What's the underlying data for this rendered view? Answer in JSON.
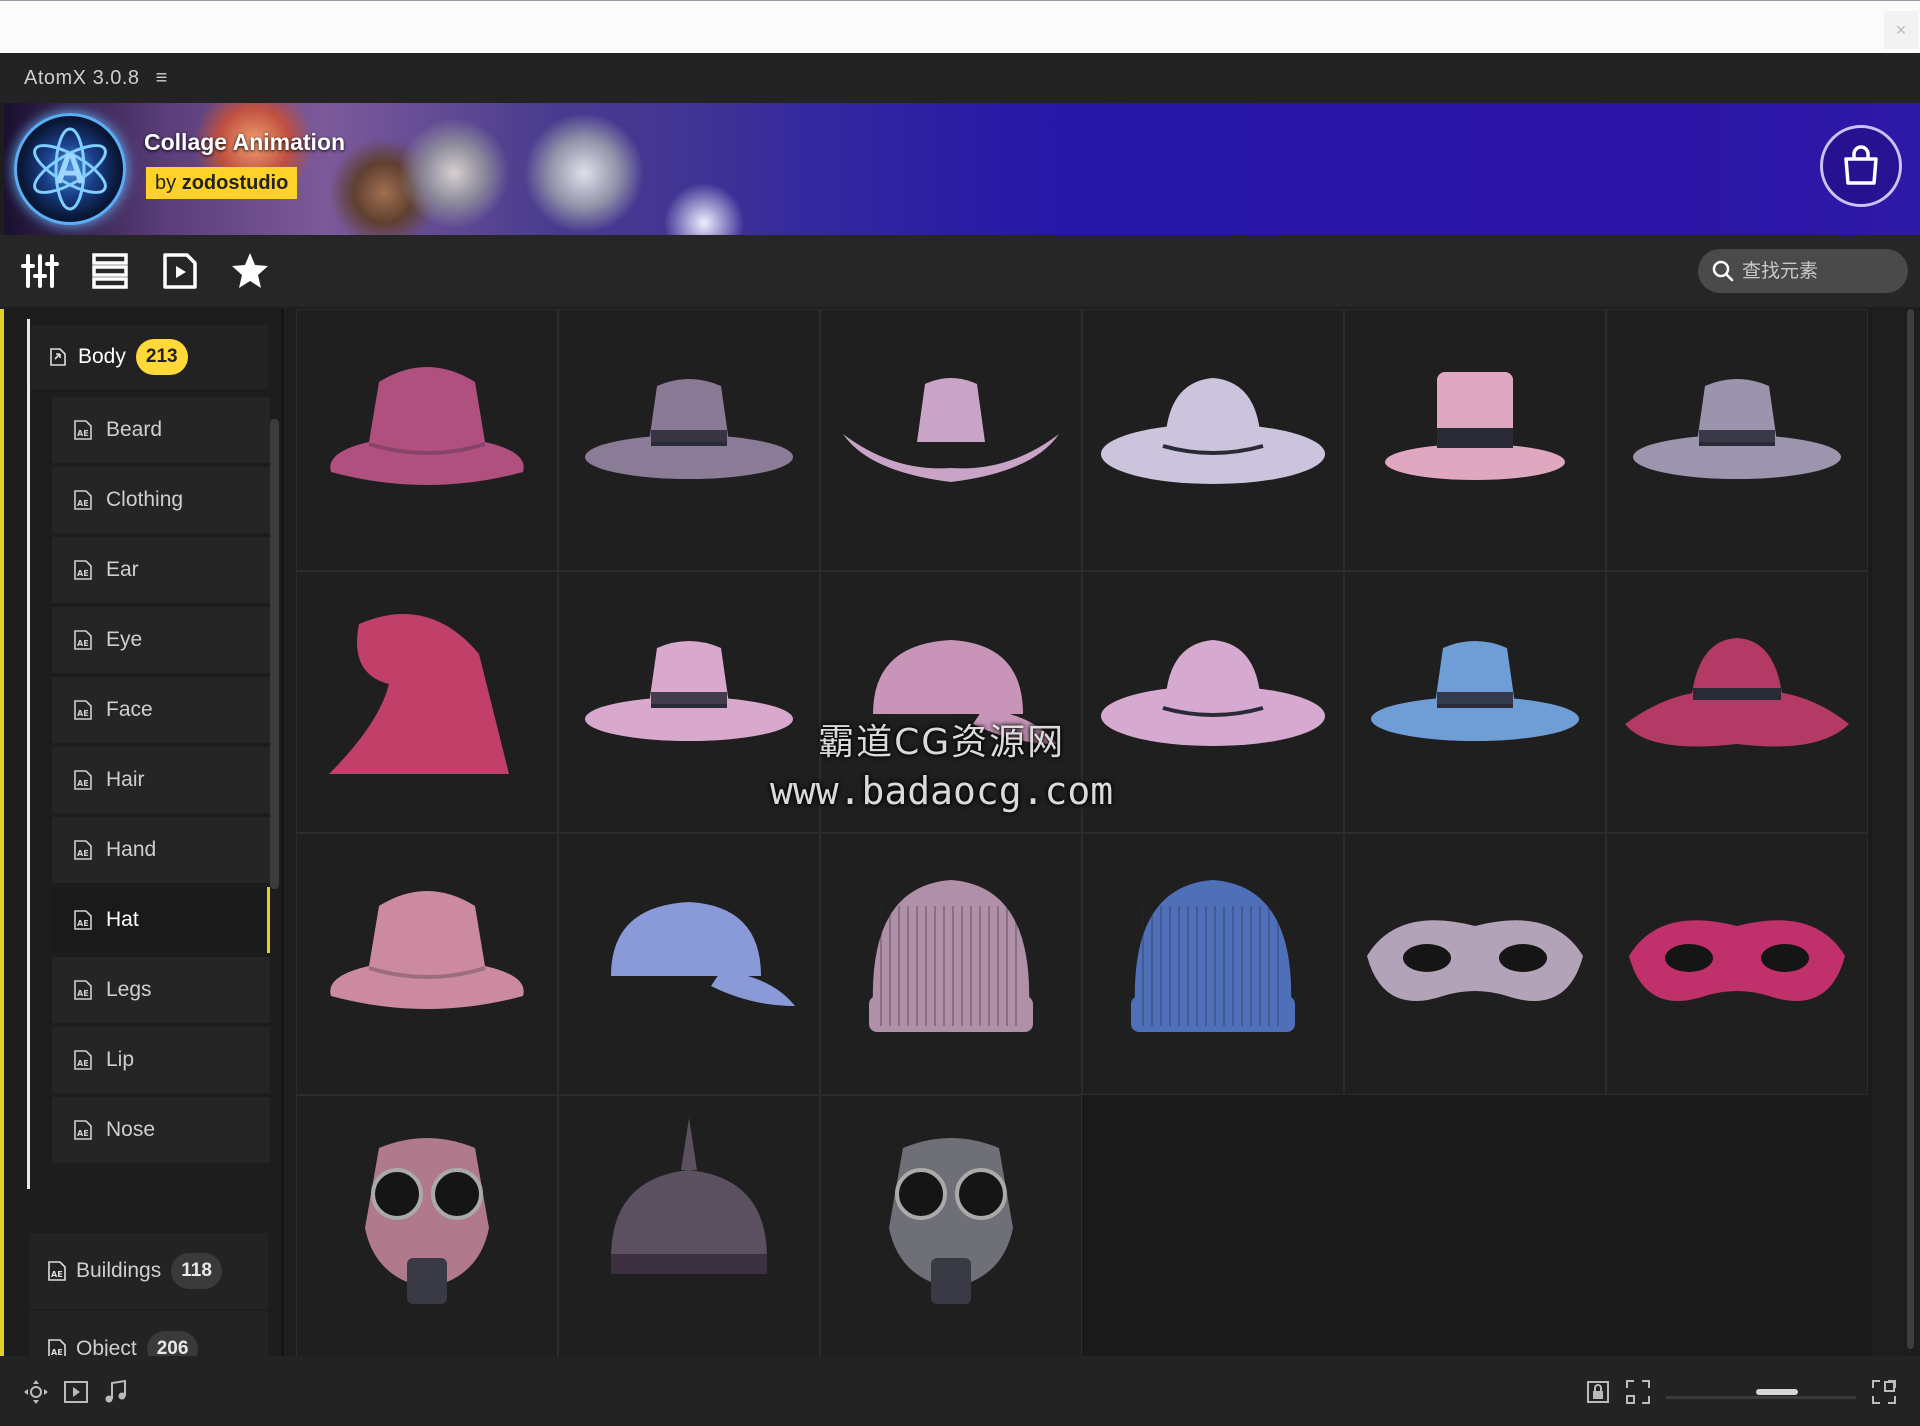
{
  "app": {
    "title": "AtomX 3.0.8",
    "menu_icon": "hamburger-menu-icon"
  },
  "banner": {
    "title": "Collage Animation",
    "author_prefix": "by ",
    "author_name": "zodostudio",
    "logo_glyph": "A",
    "shop_icon": "shopping-bag-icon"
  },
  "toolbar": {
    "tools": [
      "sliders-icon",
      "list-icon",
      "media-file-icon",
      "star-icon"
    ],
    "search": {
      "placeholder": "查找元素",
      "value": ""
    }
  },
  "sidebar": {
    "body_category": {
      "label": "Body",
      "count": "213"
    },
    "sub_items": [
      {
        "label": "Beard"
      },
      {
        "label": "Clothing"
      },
      {
        "label": "Ear"
      },
      {
        "label": "Eye"
      },
      {
        "label": "Face"
      },
      {
        "label": "Hair"
      },
      {
        "label": "Hand"
      },
      {
        "label": "Hat",
        "active": true
      },
      {
        "label": "Legs"
      },
      {
        "label": "Lip"
      },
      {
        "label": "Nose"
      }
    ],
    "other_categories": [
      {
        "label": "Buildings",
        "count": "118"
      },
      {
        "label": "Object",
        "count": "206"
      }
    ]
  },
  "grid": {
    "items": [
      {
        "name": "pink-bucket-hat",
        "color": "#b0507f"
      },
      {
        "name": "grey-feather-fedora",
        "color": "#8a7b96"
      },
      {
        "name": "cowboy-hat",
        "color": "#c9a4c6"
      },
      {
        "name": "wide-brim-felt-hat",
        "color": "#cbc4dc"
      },
      {
        "name": "top-hat",
        "color": "#e0a7c0"
      },
      {
        "name": "grey-fedora",
        "color": "#9d95ad"
      },
      {
        "name": "wizard-hat",
        "color": "#c0406a"
      },
      {
        "name": "pink-fedora",
        "color": "#d9a8cd"
      },
      {
        "name": "pink-baseball-cap",
        "color": "#c895b8"
      },
      {
        "name": "pink-wide-fedora",
        "color": "#d6aad0"
      },
      {
        "name": "blue-fedora",
        "color": "#6f9ed6"
      },
      {
        "name": "red-floppy-hat",
        "color": "#b23a64"
      },
      {
        "name": "striped-sun-hat",
        "color": "#cc8aa0"
      },
      {
        "name": "ny-baseball-cap",
        "color": "#8a9ad8"
      },
      {
        "name": "knit-beanie",
        "color": "#b08fa8"
      },
      {
        "name": "blue-beanie",
        "color": "#4f6fb8"
      },
      {
        "name": "silver-masquerade-mask",
        "color": "#b3a3b8"
      },
      {
        "name": "feather-masquerade-mask",
        "color": "#c0306a"
      },
      {
        "name": "steampunk-gas-mask",
        "color": "#b07a8c"
      },
      {
        "name": "pickelhaube-helmet",
        "color": "#5a5060"
      },
      {
        "name": "gas-mask",
        "color": "#6f6f78"
      }
    ]
  },
  "watermark": {
    "line1": "霸道CG资源网",
    "line2": "www.badaocg.com"
  },
  "footer": {
    "left_icons": [
      "move-icon",
      "play-file-icon",
      "music-note-icon"
    ],
    "right_icons": [
      "lock-icon",
      "fit-frame-icon",
      "expand-icon"
    ]
  },
  "colors": {
    "accent": "#e2cf2e",
    "background": "#1e1e1e",
    "badge_active": "#ffd83a"
  }
}
